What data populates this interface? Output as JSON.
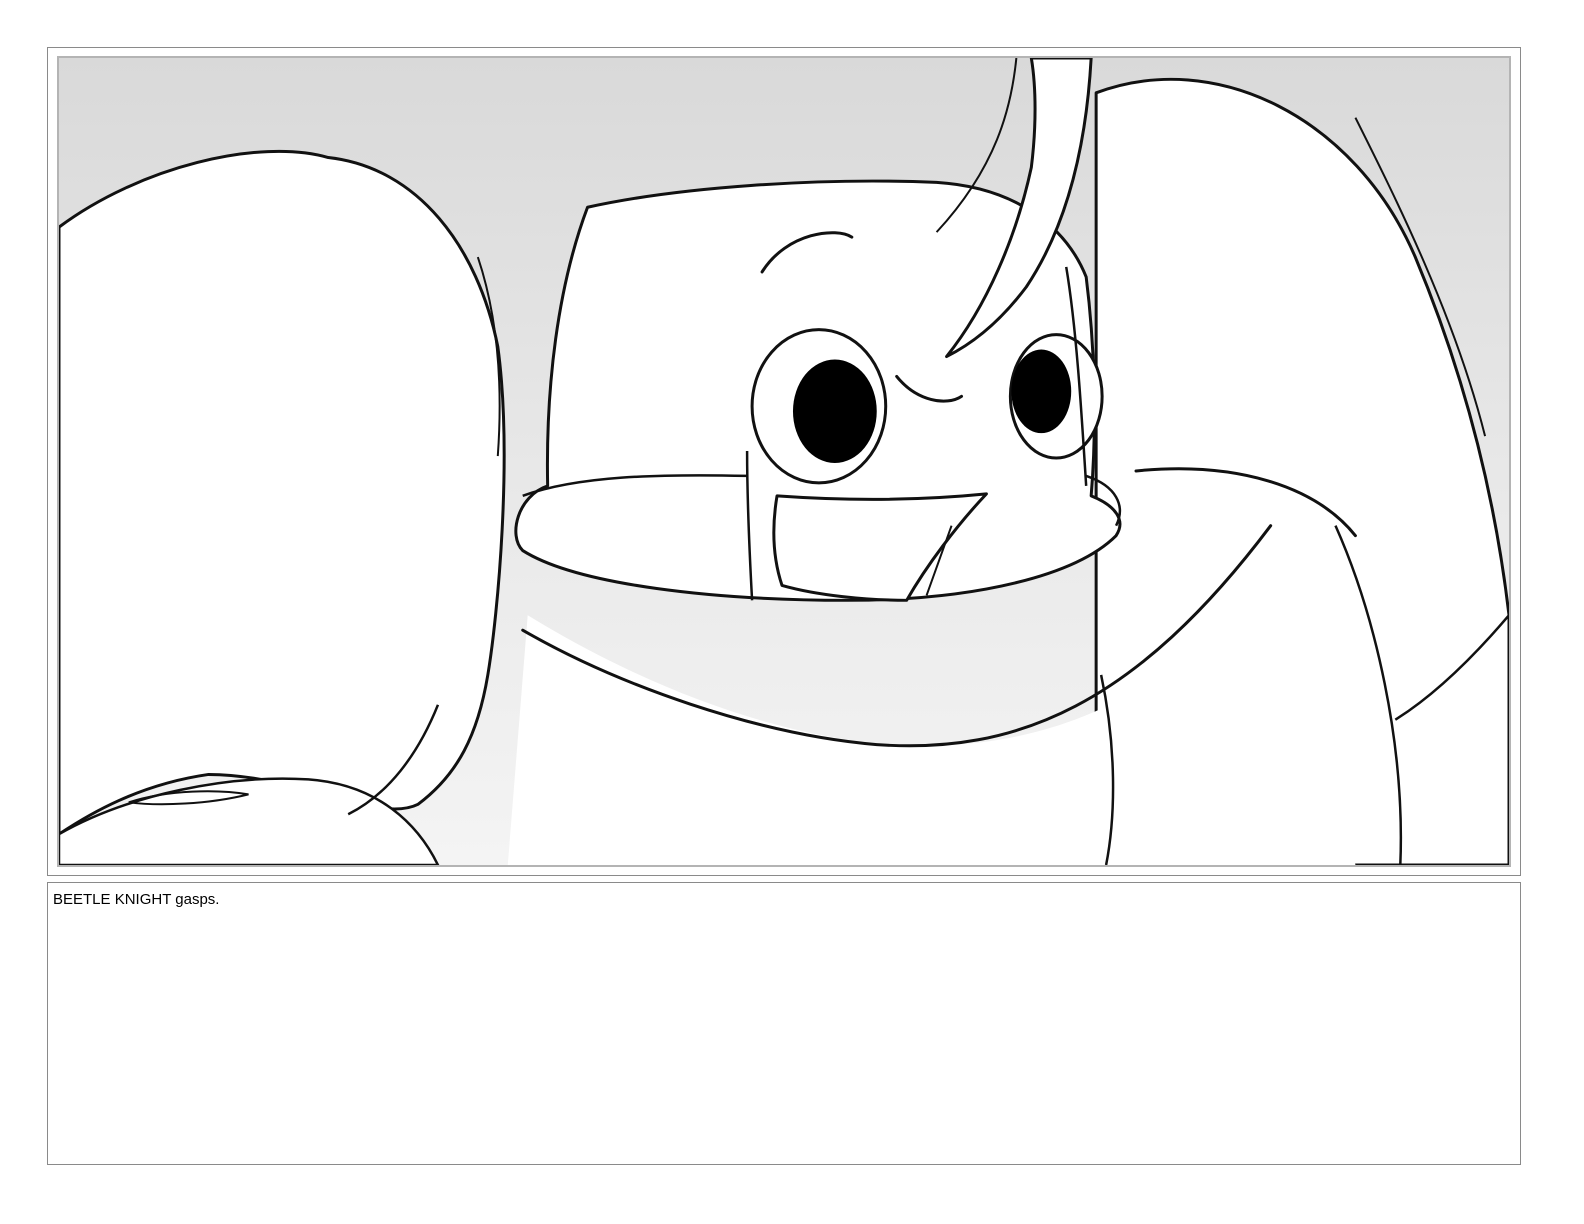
{
  "storyboard": {
    "panel": {
      "sky_color": "#dedede",
      "line_color": "#111111"
    },
    "caption": {
      "text": "BEETLE KNIGHT gasps."
    }
  }
}
